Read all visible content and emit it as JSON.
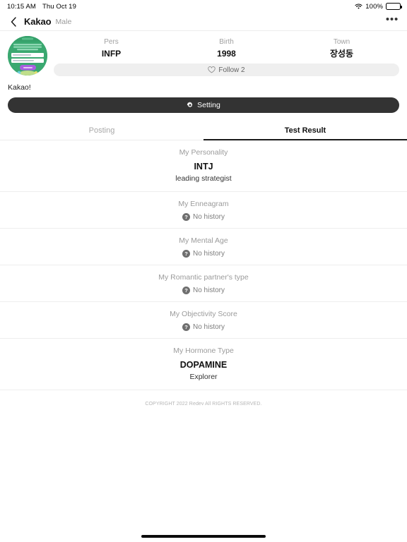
{
  "status_bar": {
    "time": "10:15 AM",
    "date": "Thu Oct 19",
    "wifi_icon": "wifi-icon",
    "battery_percent": "100%",
    "battery_icon": "battery-icon"
  },
  "navbar": {
    "back_icon": "chevron-left-icon",
    "title": "Kakao",
    "subtitle": "Male",
    "more_icon": "more-horizontal-icon",
    "more_label": "•••"
  },
  "profile": {
    "avatar_name": "profile-avatar",
    "stats": [
      {
        "label": "Pers",
        "value": "INFP"
      },
      {
        "label": "Birth",
        "value": "1998"
      },
      {
        "label": "Town",
        "value": "장성동"
      }
    ],
    "follow": {
      "icon": "heart-outline-icon",
      "label": "Follow 2"
    },
    "bio": "Kakao!"
  },
  "setting_button": {
    "icon": "gear-icon",
    "label": "Setting"
  },
  "tabs": [
    {
      "label": "Posting",
      "active": false
    },
    {
      "label": "Test Result",
      "active": true
    }
  ],
  "results": [
    {
      "title": "My Personality",
      "value": "INTJ",
      "desc": "leading strategist",
      "no_history": null
    },
    {
      "title": "My Enneagram",
      "value": null,
      "desc": null,
      "no_history": "No history"
    },
    {
      "title": "My Mental Age",
      "value": null,
      "desc": null,
      "no_history": "No history"
    },
    {
      "title": "My Romantic partner's type",
      "value": null,
      "desc": null,
      "no_history": "No history"
    },
    {
      "title": "My Objectivity Score",
      "value": null,
      "desc": null,
      "no_history": "No history"
    },
    {
      "title": "My Hormone Type",
      "value": "DOPAMINE",
      "desc": "Explorer",
      "no_history": null
    }
  ],
  "question_mark_glyph": "?",
  "copyright": "COPYRIGHT 2022 Redev All RIGHTS RESERVED.",
  "colors": {
    "accent_dark": "#333333",
    "avatar_green": "#3aa870",
    "muted_text": "#9b9b9b",
    "divider": "#eeeeee"
  }
}
